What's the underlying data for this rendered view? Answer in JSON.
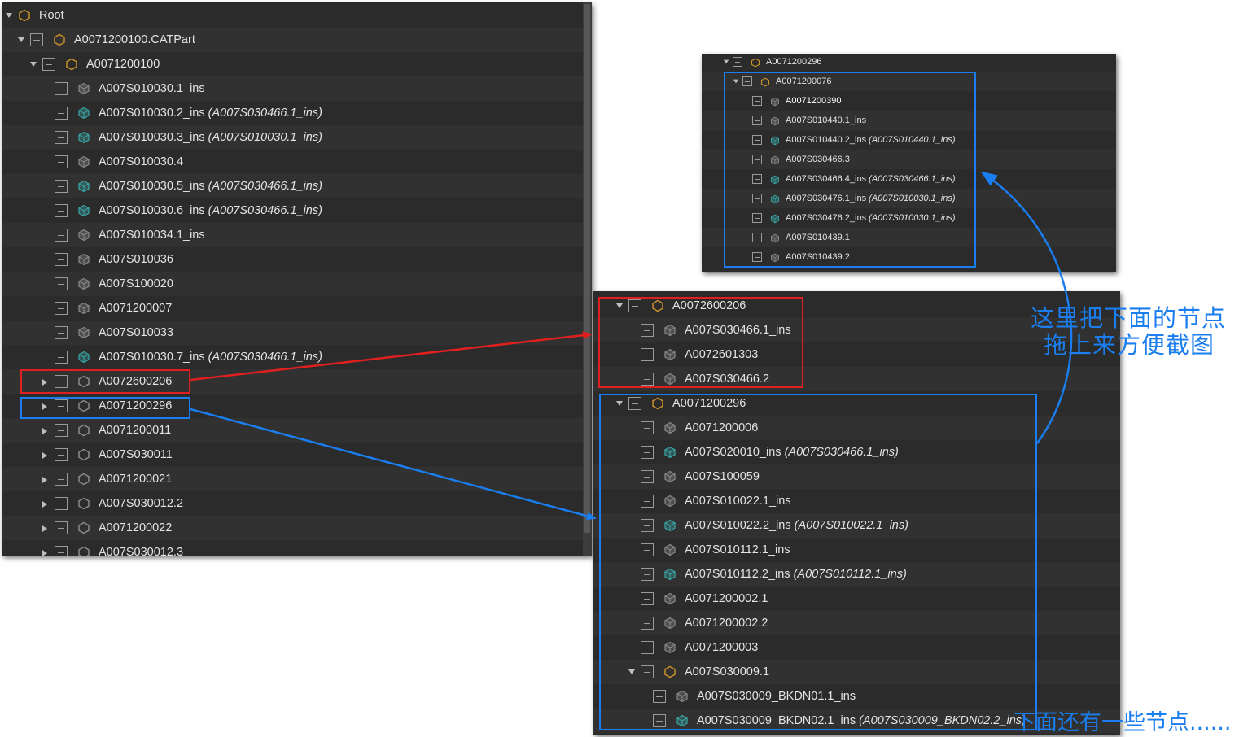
{
  "colors": {
    "red_box": "#e02020",
    "blue_box": "#1a7ef0",
    "panel_bg": "#2b2b2b",
    "row_alt": "#313131",
    "text": "#e4e4e4",
    "assembly_icon": "#c8902a",
    "part_icon_gray": "#8a8a8a",
    "part_icon_teal": "#3aa6a6"
  },
  "left_tree": {
    "rows": [
      {
        "label": "Root",
        "level": 0,
        "expander": "down",
        "checkbox": false,
        "icon": "assembly"
      },
      {
        "label": "A0071200100.CATPart",
        "level": 1,
        "expander": "down",
        "checkbox": true,
        "icon": "assembly"
      },
      {
        "label": "A0071200100",
        "level": 2,
        "expander": "down",
        "checkbox": true,
        "icon": "assembly"
      },
      {
        "label": "A007S010030.1_ins",
        "level": 3,
        "expander": "none",
        "checkbox": true,
        "icon": "part"
      },
      {
        "label": "A007S010030.2_ins",
        "suffix": "(A007S030466.1_ins)",
        "level": 3,
        "expander": "none",
        "checkbox": true,
        "icon": "instance"
      },
      {
        "label": "A007S010030.3_ins",
        "suffix": "(A007S010030.1_ins)",
        "level": 3,
        "expander": "none",
        "checkbox": true,
        "icon": "instance"
      },
      {
        "label": "A007S010030.4",
        "level": 3,
        "expander": "none",
        "checkbox": true,
        "icon": "part"
      },
      {
        "label": "A007S010030.5_ins",
        "suffix": "(A007S030466.1_ins)",
        "level": 3,
        "expander": "none",
        "checkbox": true,
        "icon": "instance"
      },
      {
        "label": "A007S010030.6_ins",
        "suffix": "(A007S030466.1_ins)",
        "level": 3,
        "expander": "none",
        "checkbox": true,
        "icon": "instance"
      },
      {
        "label": "A007S010034.1_ins",
        "level": 3,
        "expander": "none",
        "checkbox": true,
        "icon": "part"
      },
      {
        "label": "A007S010036",
        "level": 3,
        "expander": "none",
        "checkbox": true,
        "icon": "part"
      },
      {
        "label": "A007S100020",
        "level": 3,
        "expander": "none",
        "checkbox": true,
        "icon": "part"
      },
      {
        "label": "A0071200007",
        "level": 3,
        "expander": "none",
        "checkbox": true,
        "icon": "part"
      },
      {
        "label": "A007S010033",
        "level": 3,
        "expander": "none",
        "checkbox": true,
        "icon": "part"
      },
      {
        "label": "A007S010030.7_ins",
        "suffix": "(A007S030466.1_ins)",
        "level": 3,
        "expander": "none",
        "checkbox": true,
        "icon": "instance"
      },
      {
        "label": "A0072600206",
        "level": 3,
        "expander": "right",
        "checkbox": true,
        "icon": "assembly-gray"
      },
      {
        "label": "A0071200296",
        "level": 3,
        "expander": "right",
        "checkbox": true,
        "icon": "assembly-gray"
      },
      {
        "label": "A0071200011",
        "level": 3,
        "expander": "right",
        "checkbox": true,
        "icon": "assembly-gray"
      },
      {
        "label": "A007S030011",
        "level": 3,
        "expander": "right",
        "checkbox": true,
        "icon": "assembly-gray"
      },
      {
        "label": "A0071200021",
        "level": 3,
        "expander": "right",
        "checkbox": true,
        "icon": "assembly-gray"
      },
      {
        "label": "A007S030012.2",
        "level": 3,
        "expander": "right",
        "checkbox": true,
        "icon": "assembly-gray"
      },
      {
        "label": "A0071200022",
        "level": 3,
        "expander": "right",
        "checkbox": true,
        "icon": "assembly-gray"
      },
      {
        "label": "A007S030012.3",
        "level": 3,
        "expander": "right",
        "checkbox": true,
        "icon": "assembly-gray"
      }
    ]
  },
  "top_right_tree": {
    "rows": [
      {
        "label": "A0071200296",
        "level": 0,
        "expander": "down",
        "checkbox": true,
        "icon": "assembly"
      },
      {
        "label": "A0071200076",
        "level": 1,
        "expander": "down",
        "checkbox": true,
        "icon": "assembly"
      },
      {
        "label": "A0071200390",
        "level": 2,
        "expander": "none",
        "checkbox": true,
        "icon": "part",
        "bright": true
      },
      {
        "label": "A007S010440.1_ins",
        "level": 2,
        "expander": "none",
        "checkbox": true,
        "icon": "part"
      },
      {
        "label": "A007S010440.2_ins",
        "suffix": "(A007S010440.1_ins)",
        "level": 2,
        "expander": "none",
        "checkbox": true,
        "icon": "instance"
      },
      {
        "label": "A007S030466.3",
        "level": 2,
        "expander": "none",
        "checkbox": true,
        "icon": "part"
      },
      {
        "label": "A007S030466.4_ins",
        "suffix": "(A007S030466.1_ins)",
        "level": 2,
        "expander": "none",
        "checkbox": true,
        "icon": "instance"
      },
      {
        "label": "A007S030476.1_ins",
        "suffix": "(A007S010030.1_ins)",
        "level": 2,
        "expander": "none",
        "checkbox": true,
        "icon": "instance"
      },
      {
        "label": "A007S030476.2_ins",
        "suffix": "(A007S010030.1_ins)",
        "level": 2,
        "expander": "none",
        "checkbox": true,
        "icon": "instance"
      },
      {
        "label": "A007S010439.1",
        "level": 2,
        "expander": "none",
        "checkbox": true,
        "icon": "part"
      },
      {
        "label": "A007S010439.2",
        "level": 2,
        "expander": "none",
        "checkbox": true,
        "icon": "part"
      }
    ]
  },
  "bottom_right_tree": {
    "rows": [
      {
        "label": "A0072600206",
        "level": 0,
        "expander": "down",
        "checkbox": true,
        "icon": "assembly"
      },
      {
        "label": "A007S030466.1_ins",
        "level": 1,
        "expander": "none",
        "checkbox": true,
        "icon": "part"
      },
      {
        "label": "A0072601303",
        "level": 1,
        "expander": "none",
        "checkbox": true,
        "icon": "part"
      },
      {
        "label": "A007S030466.2",
        "level": 1,
        "expander": "none",
        "checkbox": true,
        "icon": "part"
      },
      {
        "label": "A0071200296",
        "level": 0,
        "expander": "down",
        "checkbox": true,
        "icon": "assembly"
      },
      {
        "label": "A0071200006",
        "level": 1,
        "expander": "none",
        "checkbox": true,
        "icon": "part"
      },
      {
        "label": "A007S020010_ins",
        "suffix": "(A007S030466.1_ins)",
        "level": 1,
        "expander": "none",
        "checkbox": true,
        "icon": "instance"
      },
      {
        "label": "A007S100059",
        "level": 1,
        "expander": "none",
        "checkbox": true,
        "icon": "part"
      },
      {
        "label": "A007S010022.1_ins",
        "level": 1,
        "expander": "none",
        "checkbox": true,
        "icon": "part"
      },
      {
        "label": "A007S010022.2_ins",
        "suffix": "(A007S010022.1_ins)",
        "level": 1,
        "expander": "none",
        "checkbox": true,
        "icon": "instance"
      },
      {
        "label": "A007S010112.1_ins",
        "level": 1,
        "expander": "none",
        "checkbox": true,
        "icon": "part"
      },
      {
        "label": "A007S010112.2_ins",
        "suffix": "(A007S010112.1_ins)",
        "level": 1,
        "expander": "none",
        "checkbox": true,
        "icon": "instance"
      },
      {
        "label": "A0071200002.1",
        "level": 1,
        "expander": "none",
        "checkbox": true,
        "icon": "part"
      },
      {
        "label": "A0071200002.2",
        "level": 1,
        "expander": "none",
        "checkbox": true,
        "icon": "part"
      },
      {
        "label": "A0071200003",
        "level": 1,
        "expander": "none",
        "checkbox": true,
        "icon": "part"
      },
      {
        "label": "A007S030009.1",
        "level": 1,
        "expander": "down",
        "checkbox": true,
        "icon": "assembly"
      },
      {
        "label": "A007S030009_BKDN01.1_ins",
        "level": 2,
        "expander": "none",
        "checkbox": true,
        "icon": "part"
      },
      {
        "label": "A007S030009_BKDN02.1_ins",
        "suffix": "(A007S030009_BKDN02.2_ins)",
        "level": 2,
        "expander": "none",
        "checkbox": true,
        "icon": "instance"
      }
    ]
  },
  "annotations": {
    "note_drag_line1": "这里把下面的节点",
    "note_drag_line2": "拖上来方便截图",
    "note_more_nodes": "下面还有一些节点......"
  }
}
